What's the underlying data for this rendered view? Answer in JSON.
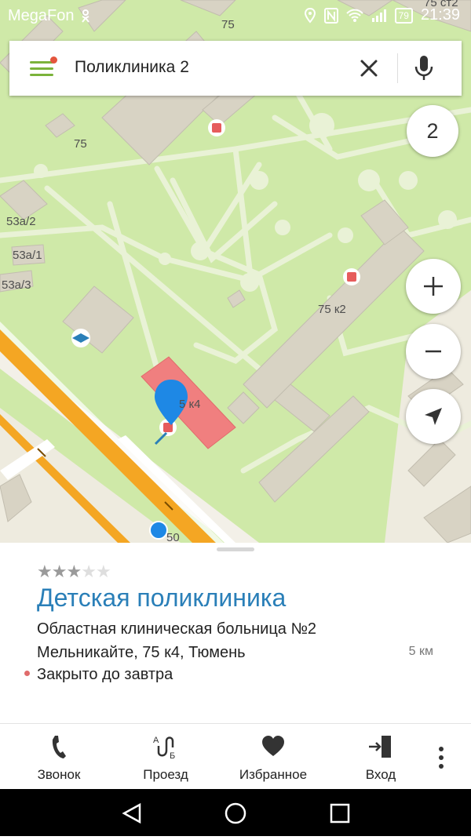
{
  "status_bar": {
    "carrier": "MegaFon",
    "battery": "79",
    "time": "21:39"
  },
  "search": {
    "query": "Поликлиника 2"
  },
  "map": {
    "layer_count": "2",
    "labels": {
      "b75_top": "75",
      "b75_left": "75",
      "b53a2": "53а/2",
      "b53a1": "53а/1",
      "b53a3": "53а/3",
      "b75k2": "75 к2",
      "b75k4": "5 к4",
      "b75ct2": "75 ст2",
      "b50": "50"
    }
  },
  "place": {
    "rating_stars": 3,
    "rating_max": 5,
    "title": "Детская поликлиника",
    "organization": "Областная клиническая больница №2",
    "address": "Мельникайте, 75 к4, Тюмень",
    "distance": "5 км",
    "status": "Закрыто до завтра"
  },
  "actions": [
    {
      "label": "Звонок"
    },
    {
      "label": "Проезд"
    },
    {
      "label": "Избранное"
    },
    {
      "label": "Вход"
    }
  ],
  "colors": {
    "accent_green": "#7bb33b",
    "title_blue": "#2a7fb8",
    "pin_blue": "#1e88e5",
    "road_orange": "#f4a623",
    "hospital_red": "#f07f7f"
  }
}
